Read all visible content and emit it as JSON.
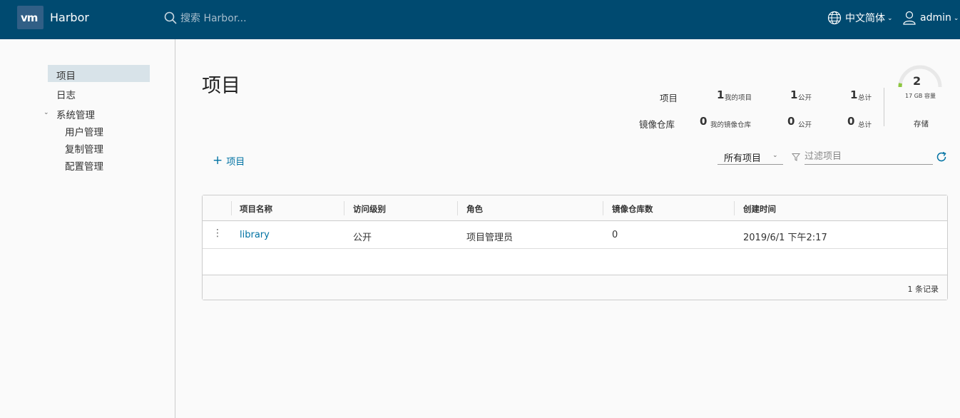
{
  "header": {
    "logo_text": "vm",
    "app_name": "Harbor",
    "search_placeholder": "搜索 Harbor...",
    "language": "中文简体",
    "user": "admin"
  },
  "sidebar": {
    "items": [
      {
        "label": "项目"
      },
      {
        "label": "日志"
      },
      {
        "label": "系统管理"
      }
    ],
    "sub_items": [
      {
        "label": "用户管理"
      },
      {
        "label": "复制管理"
      },
      {
        "label": "配置管理"
      }
    ]
  },
  "main": {
    "title": "项目",
    "stats": {
      "projects_label": "项目",
      "repos_label": "镜像仓库",
      "projects": {
        "mine": "1",
        "mine_label": "我的项目",
        "public": "1",
        "public_label": "公开",
        "total": "1",
        "total_label": "总计"
      },
      "repos": {
        "mine": "0",
        "mine_label": "我的镜像仓库",
        "public": "0",
        "public_label": "公开",
        "total": "0",
        "total_label": "总计"
      },
      "storage": {
        "value": "2",
        "caption": "17 GB 容量",
        "label": "存储",
        "used_fraction": 0.06
      }
    },
    "add_button": "项目",
    "filter_select": "所有项目",
    "filter_placeholder": "过滤项目",
    "table": {
      "columns": [
        "项目名称",
        "访问级别",
        "角色",
        "镜像仓库数",
        "创建时间"
      ],
      "rows": [
        {
          "name": "library",
          "access": "公开",
          "role": "项目管理员",
          "repo_count": "0",
          "created": "2019/6/1 下午2:17"
        }
      ],
      "footer": "1 条记录"
    }
  },
  "colors": {
    "header_bg": "#004a70",
    "link": "#0072a3",
    "gauge_fill": "#8cc63f"
  }
}
